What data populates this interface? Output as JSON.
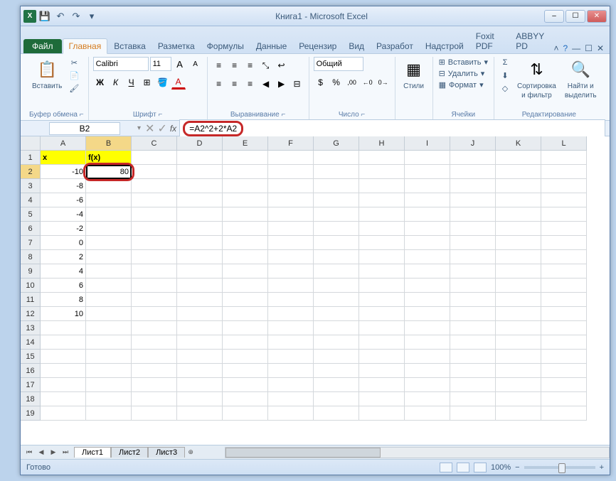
{
  "title": "Книга1 - Microsoft Excel",
  "qat": {
    "excel": "X",
    "save_icon": "💾",
    "undo_icon": "↶",
    "redo_icon": "↷",
    "dd_icon": "▾"
  },
  "win": {
    "min": "–",
    "max": "☐",
    "close": "✕"
  },
  "tabs": {
    "file": "Файл",
    "items": [
      "Главная",
      "Вставка",
      "Разметка",
      "Формулы",
      "Данные",
      "Рецензир",
      "Вид",
      "Разработ",
      "Надстрой",
      "Foxit PDF",
      "ABBYY PD"
    ],
    "active": 0
  },
  "help": {
    "caret": "˄",
    "q": "?",
    "box": "☐",
    "dash": "—",
    "x": "✕"
  },
  "ribbon": {
    "clipboard": {
      "paste_icon": "📋",
      "paste": "Вставить",
      "cut": "✂",
      "copy": "📄",
      "brush": "🖌",
      "label": "Буфер обмена",
      "expand": "⌐"
    },
    "font": {
      "name": "Calibri",
      "size": "11",
      "bold": "Ж",
      "italic": "К",
      "underline": "Ч",
      "border": "⊞",
      "fill": "🪣",
      "color": "A",
      "grow": "A",
      "shrink": "A",
      "label": "Шрифт",
      "expand": "⌐"
    },
    "align": {
      "top": "≡",
      "mid": "≡",
      "bot": "≡",
      "left": "≡",
      "center": "≡",
      "right": "≡",
      "wrap": "↩",
      "merge": "⊟",
      "indent_l": "◀",
      "indent_r": "▶",
      "orient": "⤡",
      "label": "Выравнивание",
      "expand": "⌐"
    },
    "number": {
      "format": "Общий",
      "pct": "%",
      "comma": ",00",
      "dec_inc": "←0",
      "dec_dec": "0→",
      "cur": "$",
      "label": "Число",
      "expand": "⌐"
    },
    "styles": {
      "icon": "▦",
      "label_btn": "Стили",
      "label": ""
    },
    "cells": {
      "insert": "Вставить",
      "delete": "Удалить",
      "format": "Формат",
      "ins_icon": "⊞",
      "del_icon": "⊟",
      "fmt_icon": "▦",
      "label": "Ячейки"
    },
    "editing": {
      "sum": "Σ",
      "fill": "⬇",
      "clear": "◇",
      "sort_icon": "⇅",
      "sort": "Сортировка",
      "filter": "и фильтр",
      "find_icon": "🔍",
      "find": "Найти и",
      "select": "выделить",
      "label": "Редактирование"
    }
  },
  "namebox": "B2",
  "fx_cancel": "✕",
  "fx_ok": "✓",
  "fx": "fx",
  "formula": "=A2^2+2*A2",
  "columns": [
    "A",
    "B",
    "C",
    "D",
    "E",
    "F",
    "G",
    "H",
    "I",
    "J",
    "K",
    "L"
  ],
  "rows": [
    "1",
    "2",
    "3",
    "4",
    "5",
    "6",
    "7",
    "8",
    "9",
    "10",
    "11",
    "12",
    "13",
    "14",
    "15",
    "16",
    "17",
    "18",
    "19"
  ],
  "headers": {
    "x": "x",
    "fx": "f(x)"
  },
  "col_a": [
    "-10",
    "-8",
    "-6",
    "-4",
    "-2",
    "0",
    "2",
    "4",
    "6",
    "8",
    "10"
  ],
  "b2": "80",
  "sheets": {
    "nav": [
      "⏮",
      "◀",
      "▶",
      "⏭"
    ],
    "items": [
      "Лист1",
      "Лист2",
      "Лист3"
    ],
    "new": "⊕"
  },
  "status": {
    "ready": "Готово",
    "zoom": "100%",
    "minus": "−",
    "plus": "+"
  }
}
